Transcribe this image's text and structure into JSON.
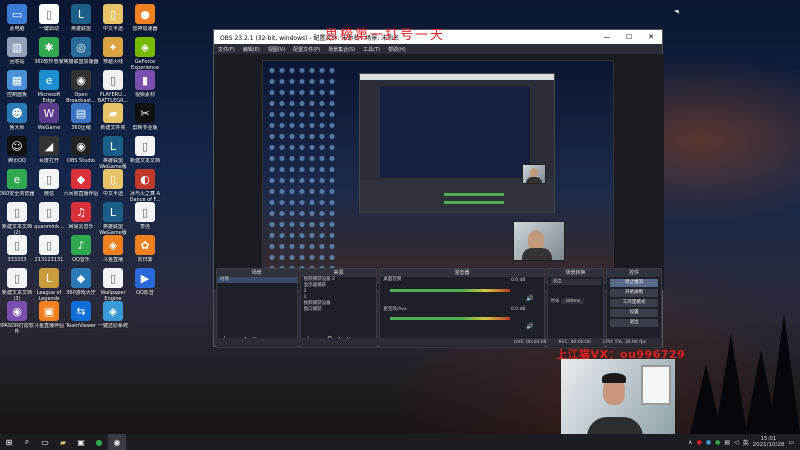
{
  "overlay": {
    "title": "思榜第一打号一天",
    "wechat": "上江猫VX：ou996729"
  },
  "desktop_icons": [
    {
      "label": "此电脑",
      "color": "#3a7bd5",
      "glyph": "▭"
    },
    {
      "label": "一键启动",
      "color": "#ffffff",
      "glyph": "▯"
    },
    {
      "label": "英雄联盟",
      "color": "#1b5f88",
      "glyph": "L"
    },
    {
      "label": "中文半透",
      "color": "#e8c468",
      "glyph": "▯"
    },
    {
      "label": "雷神加速器",
      "color": "#f08020",
      "glyph": "●"
    },
    {
      "label": "回收站",
      "color": "#8fa0b8",
      "glyph": "▥"
    },
    {
      "label": "360软件管家",
      "color": "#2fa84f",
      "glyph": "✱"
    },
    {
      "label": "英雄联盟加速器",
      "color": "#2a6a9a",
      "glyph": "◎"
    },
    {
      "label": "穿越火线",
      "color": "#d9a441",
      "glyph": "✦"
    },
    {
      "label": "GeForce Experience",
      "color": "#76b900",
      "glyph": "◈"
    },
    {
      "label": "控制面板",
      "color": "#4a8fd4",
      "glyph": "▦"
    },
    {
      "label": "Microsoft Edge",
      "color": "#1d8fd1",
      "glyph": "e"
    },
    {
      "label": "Open Broadcast...",
      "color": "#333333",
      "glyph": "◉"
    },
    {
      "label": "PLAYERU... BATTLEGR...",
      "color": "#f0f0f0",
      "glyph": "▯"
    },
    {
      "label": "视频素材",
      "color": "#7a4fb0",
      "glyph": "▮"
    },
    {
      "label": "鲁大师",
      "color": "#2a7ab8",
      "glyph": "☻"
    },
    {
      "label": "WeGame",
      "color": "#5b3a8c",
      "glyph": "W"
    },
    {
      "label": "360压缩",
      "color": "#3a74c2",
      "glyph": "▤"
    },
    {
      "label": "新建文件夹",
      "color": "#e8c468",
      "glyph": "▰"
    },
    {
      "label": "剪映专业版",
      "color": "#111111",
      "glyph": "✂"
    },
    {
      "label": "腾讯QQ",
      "color": "#111111",
      "glyph": "☺"
    },
    {
      "label": "百度打开",
      "color": "#333333",
      "glyph": "◢"
    },
    {
      "label": "OBS Studio",
      "color": "#222222",
      "glyph": "◉"
    },
    {
      "label": "英雄联盟WeGame版",
      "color": "#1b5f88",
      "glyph": "L"
    },
    {
      "label": "新建文本文档",
      "color": "#f4f4f4",
      "glyph": "▯"
    },
    {
      "label": "360安全浏览器",
      "color": "#2fa84f",
      "glyph": "e"
    },
    {
      "label": "微信",
      "color": "#f4f4f4",
      "glyph": "▯"
    },
    {
      "label": "六间房直播伴侣",
      "color": "#d9313a",
      "glyph": "◆"
    },
    {
      "label": "中文半透",
      "color": "#e8c468",
      "glyph": "▯"
    },
    {
      "label": "冰与火之舞 A Dance of F...",
      "color": "#c0392b",
      "glyph": "◐"
    },
    {
      "label": "新建文本文档(2)",
      "color": "#f4f4f4",
      "glyph": "▯"
    },
    {
      "label": "quanmink...",
      "color": "#f4f4f4",
      "glyph": "▯"
    },
    {
      "label": "网易云音乐",
      "color": "#d9313a",
      "glyph": "♫"
    },
    {
      "label": "英雄联盟WeGame版",
      "color": "#1b5f88",
      "glyph": "L"
    },
    {
      "label": "李佳",
      "color": "#f4f4f4",
      "glyph": "▯"
    },
    {
      "label": "333333",
      "color": "#f4f4f4",
      "glyph": "▯"
    },
    {
      "label": "213123131",
      "color": "#f4f4f4",
      "glyph": "▯"
    },
    {
      "label": "QQ音乐",
      "color": "#2fa84f",
      "glyph": "♪"
    },
    {
      "label": "斗鱼直播",
      "color": "#f08020",
      "glyph": "◈"
    },
    {
      "label": "向日葵",
      "color": "#f08020",
      "glyph": "✿"
    },
    {
      "label": "新建文本文档(3)",
      "color": "#f4f4f4",
      "glyph": "▯"
    },
    {
      "label": "League of Legends",
      "color": "#c89b3c",
      "glyph": "L"
    },
    {
      "label": "360游戏大厅",
      "color": "#2a7ab8",
      "glyph": "◆"
    },
    {
      "label": "Wallpaper Engine",
      "color": "#f4f4f4",
      "glyph": "▯"
    },
    {
      "label": "QQ影音",
      "color": "#2a6ad8",
      "glyph": "▶"
    },
    {
      "label": "IPASON打造软件",
      "color": "#7a4fb0",
      "glyph": "◉"
    },
    {
      "label": "斗鱼直播伴侣",
      "color": "#f08020",
      "glyph": "▣"
    },
    {
      "label": "TeamViewer",
      "color": "#0e6fd6",
      "glyph": "⇆"
    },
    {
      "label": "一键还原系统",
      "color": "#3a9ad8",
      "glyph": "◈"
    }
  ],
  "obs": {
    "title": "OBS 23.2.1 (32-bit, windows) - 配置文件: 未命名 - 场景: 未命名",
    "menu": [
      "文件(F)",
      "编辑(E)",
      "视图(V)",
      "配置文件(P)",
      "场景集合(S)",
      "工具(T)",
      "帮助(H)"
    ],
    "docks": {
      "scenes": {
        "header": "场景",
        "items": [
          "场景"
        ]
      },
      "sources": {
        "header": "来源",
        "items": [
          "视频捕获设备 2",
          "显示器捕获",
          "2",
          "1",
          "视频捕获设备",
          "窗口捕获"
        ]
      },
      "mixer": {
        "header": "混音器",
        "tracks": [
          {
            "name": "桌面音频",
            "db": "0.0 dB"
          },
          {
            "name": "麦克风/Aux",
            "db": "0.0 dB"
          }
        ]
      },
      "transitions": {
        "header": "场景转换",
        "type": "淡出",
        "duration_label": "时长",
        "duration": "300ms"
      },
      "controls": {
        "header": "控件",
        "buttons": [
          "停止推流",
          "开始录制",
          "工作室模式",
          "设置",
          "退出"
        ]
      }
    },
    "status": {
      "live": "LIVE: 00:00:00",
      "rec": "REC: 00:00:00",
      "cpu": "CPU: 5%, 30.00 fps"
    }
  },
  "taskbar": {
    "time": "15:01",
    "date": "2021/10/28",
    "lang": "英"
  }
}
